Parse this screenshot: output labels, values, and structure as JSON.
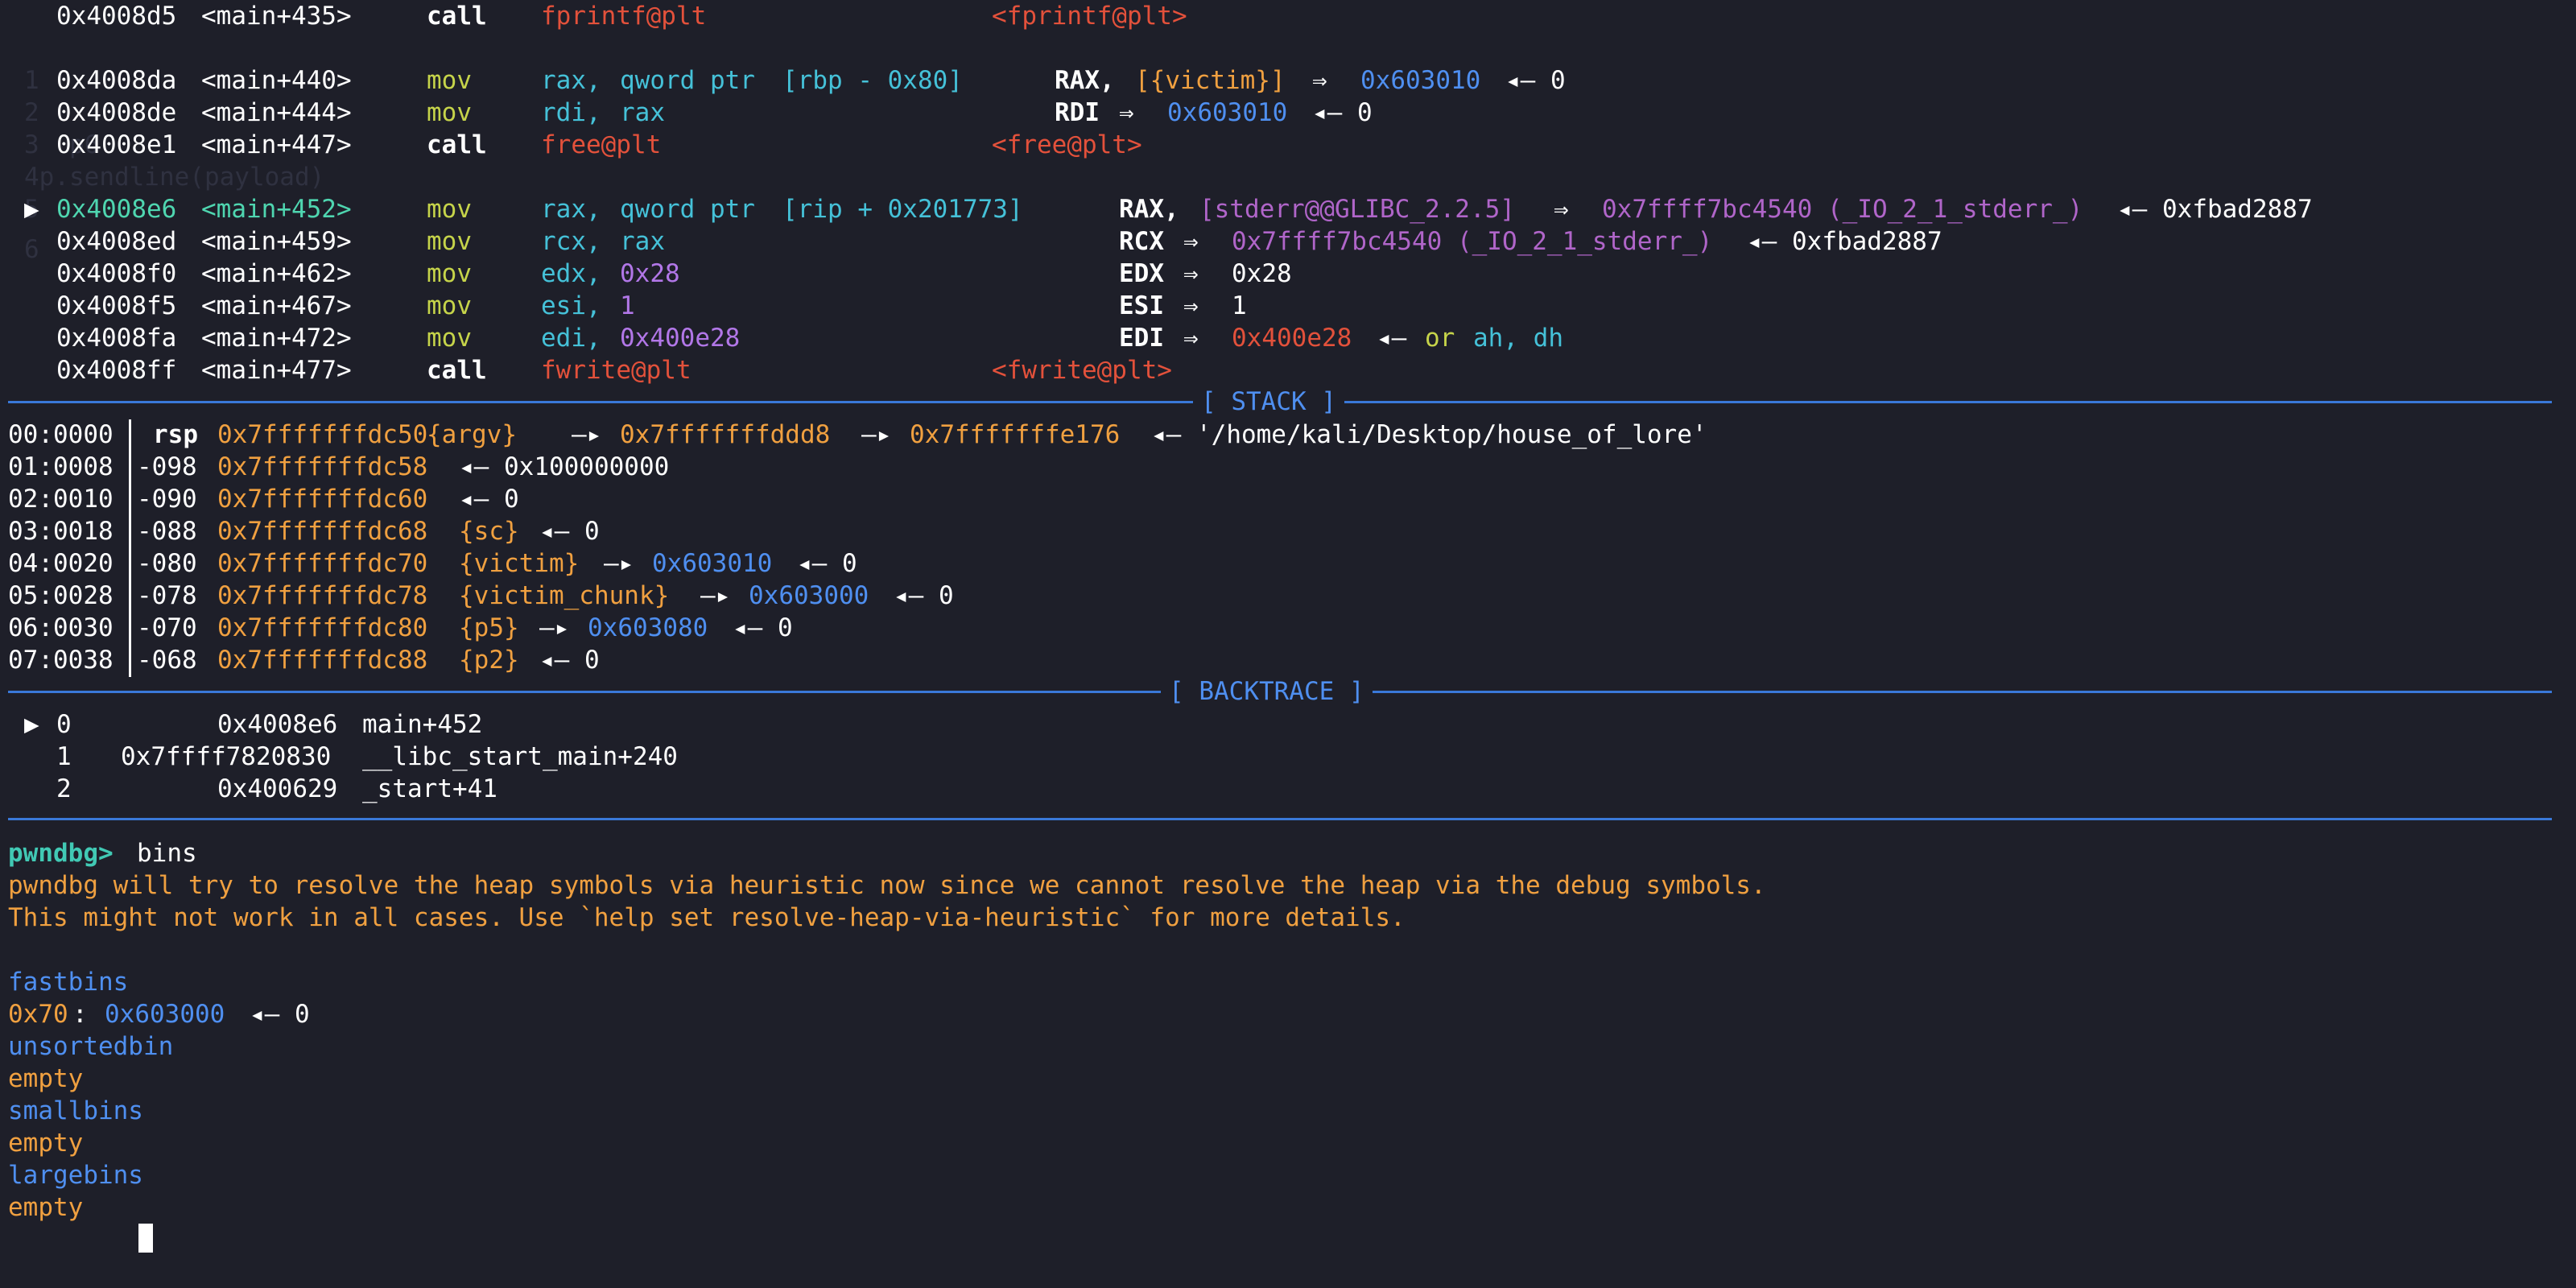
{
  "disasm": [
    {
      "marker": "",
      "addr": "0x4008d5",
      "sym": "<main+435>",
      "op": "call",
      "args": "fprintf@plt",
      "note": "<fprintf@plt>"
    },
    {
      "marker": "",
      "addr": "0x4008da",
      "sym": "<main+440>",
      "op": "mov",
      "args_a": "rax,",
      "args_b": "qword ptr",
      "args_c": "[rbp - 0x80]",
      "note_a": "RAX,",
      "note_b": "[{victim}]",
      "note_c": "⇒",
      "note_d": "0x603010",
      "note_e": "◂— 0"
    },
    {
      "marker": "",
      "addr": "0x4008de",
      "sym": "<main+444>",
      "op": "mov",
      "args_a": "rdi,",
      "args_b": "rax",
      "note_a": "RDI",
      "note_c": "⇒",
      "note_d": "0x603010",
      "note_e": "◂— 0"
    },
    {
      "marker": "",
      "addr": "0x4008e1",
      "sym": "<main+447>",
      "op": "call",
      "args": "free@plt",
      "note": "<free@plt>"
    },
    {
      "marker": "▶",
      "addr": "0x4008e6",
      "sym": "<main+452>",
      "op": "mov",
      "args_a": "rax,",
      "args_b": "qword ptr",
      "args_c": "[rip + 0x201773]",
      "note_a": "RAX,",
      "note_b": "[stderr@@GLIBC_2.2.5]",
      "note_c": "⇒",
      "note_d": "0x7ffff7bc4540 (_IO_2_1_stderr_)",
      "note_e": "◂— 0xfbad2887"
    },
    {
      "marker": "",
      "addr": "0x4008ed",
      "sym": "<main+459>",
      "op": "mov",
      "args_a": "rcx,",
      "args_b": "rax",
      "note_a": "RCX",
      "note_c": "⇒",
      "note_d": "0x7ffff7bc4540 (_IO_2_1_stderr_)",
      "note_e": "◂— 0xfbad2887"
    },
    {
      "marker": "",
      "addr": "0x4008f0",
      "sym": "<main+462>",
      "op": "mov",
      "args_a": "edx,",
      "args_b": "0x28",
      "note_a": "EDX",
      "note_c": "⇒",
      "note_d": "0x28"
    },
    {
      "marker": "",
      "addr": "0x4008f5",
      "sym": "<main+467>",
      "op": "mov",
      "args_a": "esi,",
      "args_b": "1",
      "note_a": "ESI",
      "note_c": "⇒",
      "note_d": "1"
    },
    {
      "marker": "",
      "addr": "0x4008fa",
      "sym": "<main+472>",
      "op": "mov",
      "args_a": "edi,",
      "args_b": "0x400e28",
      "note_a": "EDI",
      "note_c": "⇒",
      "note_d": "0x400e28",
      "note_e": "◂—",
      "note_f": "or",
      "note_g": "ah, dh"
    },
    {
      "marker": "",
      "addr": "0x4008ff",
      "sym": "<main+477>",
      "op": "call",
      "args": "fwrite@plt",
      "note": "<fwrite@plt>"
    }
  ],
  "ghost_text": [
    "1",
    "2",
    "3  p6",
    "4p.sendline(payload)",
    "5",
    "6"
  ],
  "sections": {
    "stack": "[ STACK ]",
    "backtrace": "[ BACKTRACE ]"
  },
  "stack": [
    {
      "idx": "00:0000",
      "off": "rsp",
      "addr": "0x7fffffffdc50",
      "tag": "{argv}",
      "rest_a": "—▸",
      "rest_b": "0x7fffffffddd8",
      "rest_c": "—▸",
      "rest_d": "0x7fffffffe176",
      "rest_e": "◂— '/home/kali/Desktop/house_of_lore'"
    },
    {
      "idx": "01:0008",
      "off": "-098",
      "addr": "0x7fffffffdc58",
      "tag": "",
      "rest_a": "◂— 0x100000000"
    },
    {
      "idx": "02:0010",
      "off": "-090",
      "addr": "0x7fffffffdc60",
      "tag": "",
      "rest_a": "◂— 0"
    },
    {
      "idx": "03:0018",
      "off": "-088",
      "addr": "0x7fffffffdc68",
      "tag": "{sc}",
      "rest_a": "◂— 0"
    },
    {
      "idx": "04:0020",
      "off": "-080",
      "addr": "0x7fffffffdc70",
      "tag": "{victim}",
      "rest_a": "—▸",
      "rest_b": "0x603010",
      "rest_e": "◂— 0"
    },
    {
      "idx": "05:0028",
      "off": "-078",
      "addr": "0x7fffffffdc78",
      "tag": "{victim_chunk}",
      "rest_a": "—▸",
      "rest_b": "0x603000",
      "rest_e": "◂— 0"
    },
    {
      "idx": "06:0030",
      "off": "-070",
      "addr": "0x7fffffffdc80",
      "tag": "{p5}",
      "rest_a": "—▸",
      "rest_b": "0x603080",
      "rest_e": "◂— 0"
    },
    {
      "idx": "07:0038",
      "off": "-068",
      "addr": "0x7fffffffdc88",
      "tag": "{p2}",
      "rest_a": "◂— 0"
    }
  ],
  "backtrace": [
    {
      "marker": "▶",
      "num": "0",
      "addr": "0x4008e6",
      "sym": "main+452"
    },
    {
      "marker": "",
      "num": "1",
      "addr": "0x7ffff7820830",
      "sym": "__libc_start_main+240"
    },
    {
      "marker": "",
      "num": "2",
      "addr": "0x400629",
      "sym": "_start+41"
    }
  ],
  "prompt": {
    "label": "pwndbg>",
    "command": "bins"
  },
  "warnings": [
    "pwndbg will try to resolve the heap symbols via heuristic now since we cannot resolve the heap via the debug symbols.",
    "This might not work in all cases. Use `help set resolve-heap-via-heuristic` for more details."
  ],
  "bins": {
    "fastbins_label": "fastbins",
    "fast_size": "0x70",
    "fast_sep": ":",
    "fast_addr": "0x603000",
    "fast_rest": "◂— 0",
    "unsorted_label": "unsortedbin",
    "unsorted_val": "empty",
    "small_label": "smallbins",
    "small_val": "empty",
    "large_label": "largebins",
    "large_val": "empty"
  },
  "colors": {
    "background": "#1e1f29",
    "rule": "#3a78d8",
    "prompt": "#41c9b4",
    "warning": "#f0a040",
    "label": "#4f8ff0"
  }
}
